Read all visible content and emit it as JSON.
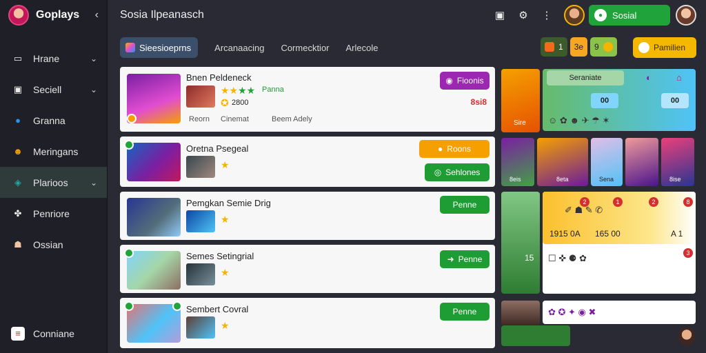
{
  "sidebar": {
    "brand": "Goplays",
    "items": [
      {
        "label": "Hrane",
        "icon": "monitor-icon",
        "chevron": true,
        "active": false
      },
      {
        "label": "Seciell",
        "icon": "bag-icon",
        "chevron": true,
        "active": false
      },
      {
        "label": "Granna",
        "icon": "globe-icon",
        "chevron": false,
        "active": false
      },
      {
        "label": "Meringans",
        "icon": "face-icon",
        "chevron": false,
        "active": false
      },
      {
        "label": "Plarioos",
        "icon": "controller-icon",
        "chevron": true,
        "active": true
      },
      {
        "label": "Penriore",
        "icon": "puzzle-icon",
        "chevron": false,
        "active": false
      },
      {
        "label": "Ossian",
        "icon": "person-icon",
        "chevron": false,
        "active": false
      }
    ],
    "bottom_item": {
      "label": "Conniane",
      "icon": "flag-icon"
    }
  },
  "topbar": {
    "title": "Sosia Ilpeanasch",
    "social_label": "Sosial"
  },
  "tabs": [
    {
      "label": "Sieesioeprns",
      "active": true
    },
    {
      "label": "Arcanaacing",
      "active": false
    },
    {
      "label": "Cormecktior",
      "active": false
    },
    {
      "label": "Arlecole",
      "active": false
    }
  ],
  "counters": [
    {
      "value": "1",
      "color": "#f26b1d"
    },
    {
      "value": "3e",
      "color": "#f5a623"
    },
    {
      "value": "9",
      "color": "#8bc34a"
    }
  ],
  "top_button": "Pamilien",
  "games": [
    {
      "name": "Bnen Peldeneck",
      "rating_text": "Panna",
      "sub_value": "2800",
      "meta": [
        "Reorn",
        "Cinemat",
        "Beem Adely"
      ],
      "action": "Fioonis",
      "action_color": "#9c27b0",
      "price": "8si8"
    },
    {
      "name": "Oretna Psegeal",
      "action": "Roons",
      "action_color": "#f5a000",
      "action2": "Sehlones",
      "action2_color": "#1f9d35"
    },
    {
      "name": "Pemgkan Semie Drig",
      "action": "Penne",
      "action_color": "#1f9d35"
    },
    {
      "name": "Semes Setingrial",
      "action": "Penne",
      "action_color": "#1f9d35"
    },
    {
      "name": "Sembert Covral",
      "action": "Penne",
      "action_color": "#1f9d35"
    }
  ],
  "right_panel": {
    "header_label": "Seraniate",
    "top_codes": [
      "00",
      "00"
    ],
    "card_labels": [
      "Sire",
      "8eis",
      "8eta",
      "Sena",
      "8ise"
    ],
    "stats": [
      "1915 0A",
      "165 00",
      "A 1",
      "15"
    ]
  }
}
